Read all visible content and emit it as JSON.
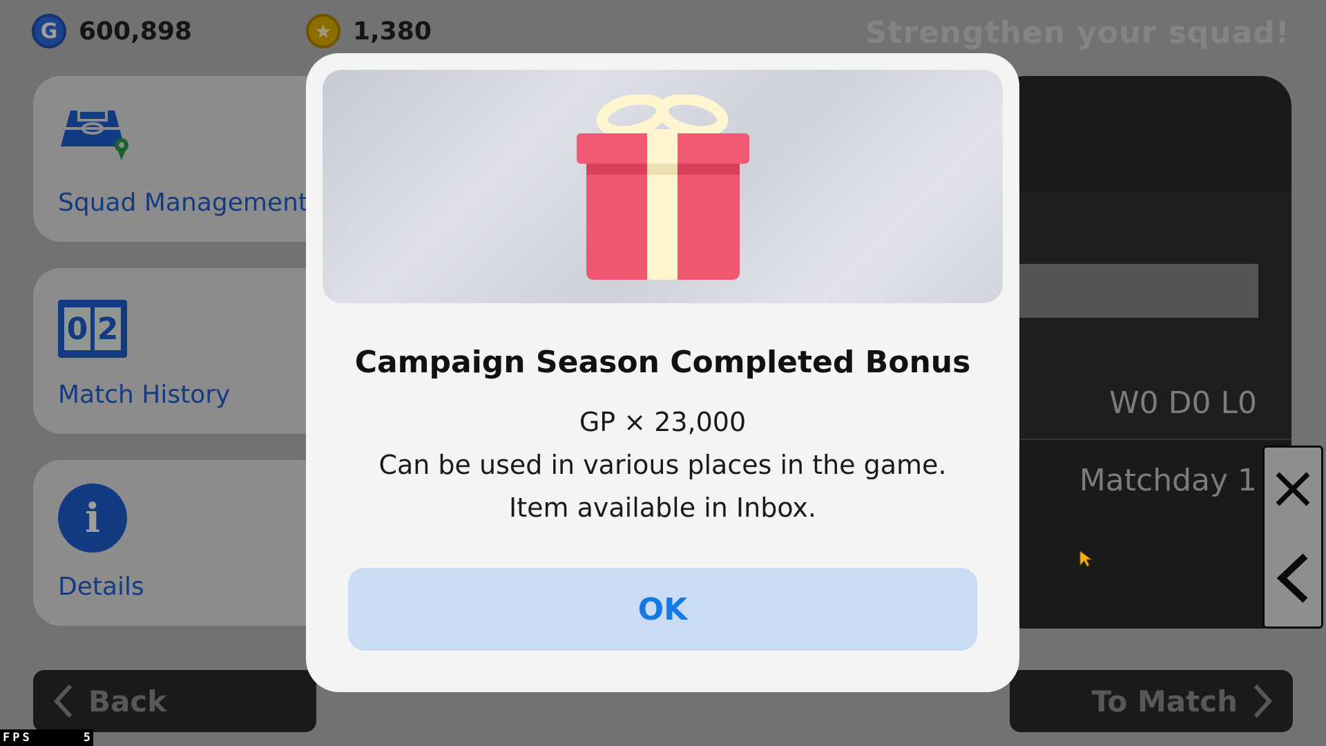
{
  "currencies": {
    "gp": {
      "icon": "gp-coin-icon",
      "label": "G",
      "value": "600,898"
    },
    "coins": {
      "icon": "star-coin-icon",
      "label": "★",
      "value": "1,380"
    }
  },
  "header": {
    "headline": "Strengthen your squad!"
  },
  "menu": [
    {
      "label": "Squad Management",
      "icon": "pitch-location-icon"
    },
    {
      "label": "Match History",
      "icon": "scoreboard-icon",
      "score_left": "0",
      "score_right": "2"
    },
    {
      "label": "Details",
      "icon": "info-icon",
      "glyph": "i"
    }
  ],
  "panel": {
    "record": "W0 D0 L0",
    "matchday": "Matchday 1"
  },
  "navigation": {
    "back_label": "Back",
    "to_match_label": "To Match"
  },
  "modal": {
    "title": "Campaign Season Completed Bonus",
    "reward": "GP × 23,000",
    "description_line1": "Can be used in various places in the game.",
    "description_line2": "Item available in Inbox.",
    "ok_label": "OK",
    "icon": "gift-icon"
  },
  "debug": {
    "fps_label": "FPS",
    "fps_value": "5"
  },
  "colors": {
    "accent_blue": "#1478e6",
    "ok_button_bg": "#c9dcf3",
    "gift_red": "#f0566f",
    "gift_ribbon": "#fff6cf"
  }
}
